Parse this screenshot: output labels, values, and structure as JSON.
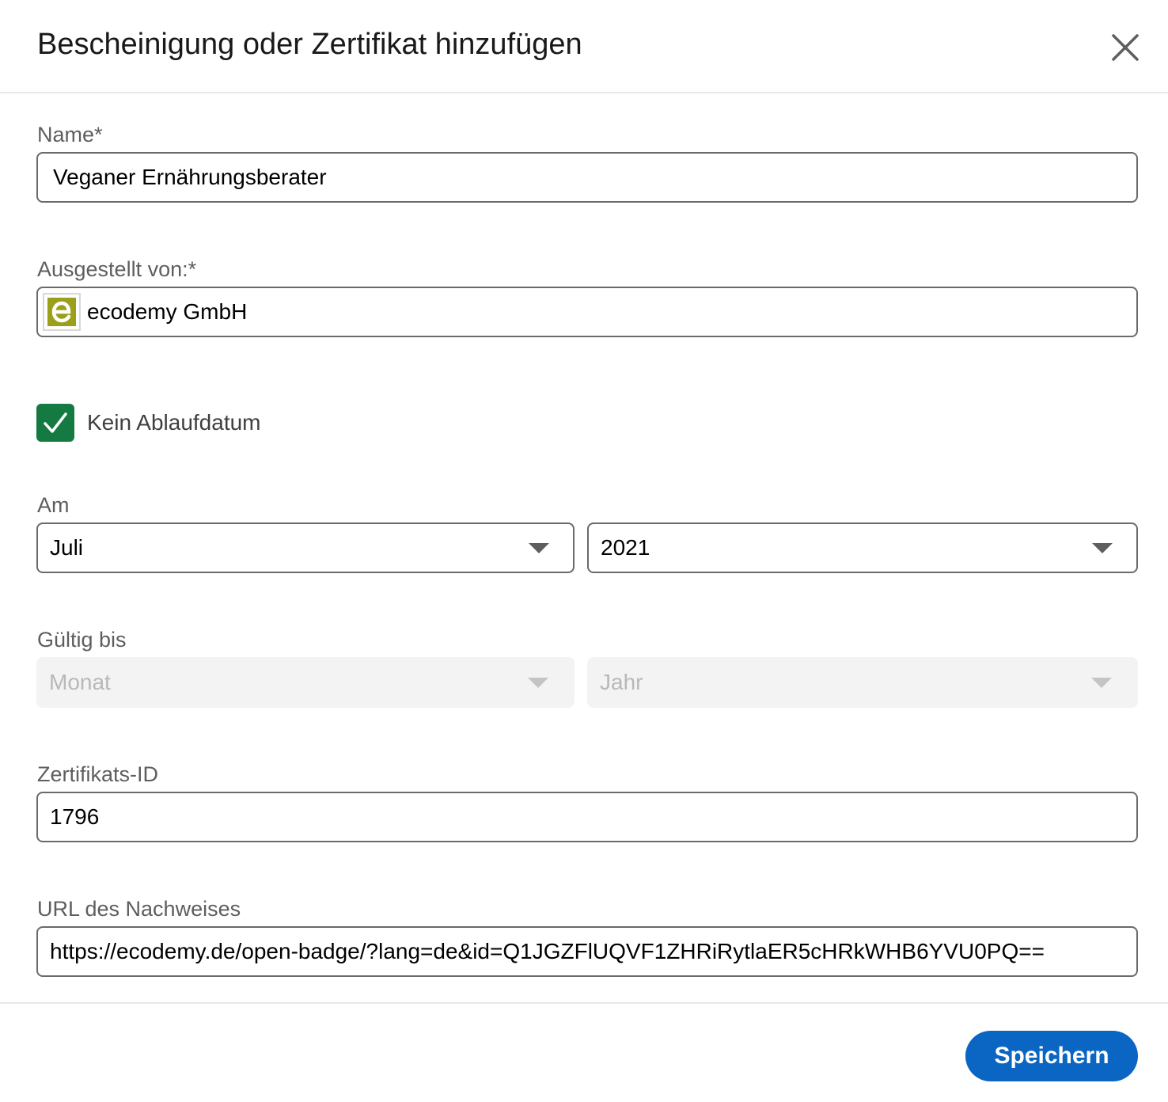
{
  "dialog": {
    "title": "Bescheinigung oder Zertifikat hinzufügen",
    "close_icon": "close-icon"
  },
  "form": {
    "name": {
      "label": "Name*",
      "value": "Veganer Ernährungsberater"
    },
    "issuer": {
      "label": "Ausgestellt von:*",
      "value": "ecodemy GmbH",
      "logo_icon": "ecodemy-logo",
      "logo_color": "#9aa01a"
    },
    "no_expiry": {
      "label": "Kein Ablaufdatum",
      "checked": true,
      "color": "#147a42"
    },
    "issued": {
      "label": "Am",
      "month": "Juli",
      "year": "2021",
      "caret_icon": "caret-down-icon"
    },
    "expires": {
      "label": "Gültig bis",
      "month_placeholder": "Monat",
      "year_placeholder": "Jahr",
      "disabled": true
    },
    "credential_id": {
      "label": "Zertifikats-ID",
      "value": "1796"
    },
    "credential_url": {
      "label": "URL des Nachweises",
      "value": "https://ecodemy.de/open-badge/?lang=de&id=Q1JGZFlUQVF1ZHRiRytlaER5cHRkWHB6YVU0PQ=="
    }
  },
  "footer": {
    "save_label": "Speichern",
    "accent": "#0a66c2"
  }
}
